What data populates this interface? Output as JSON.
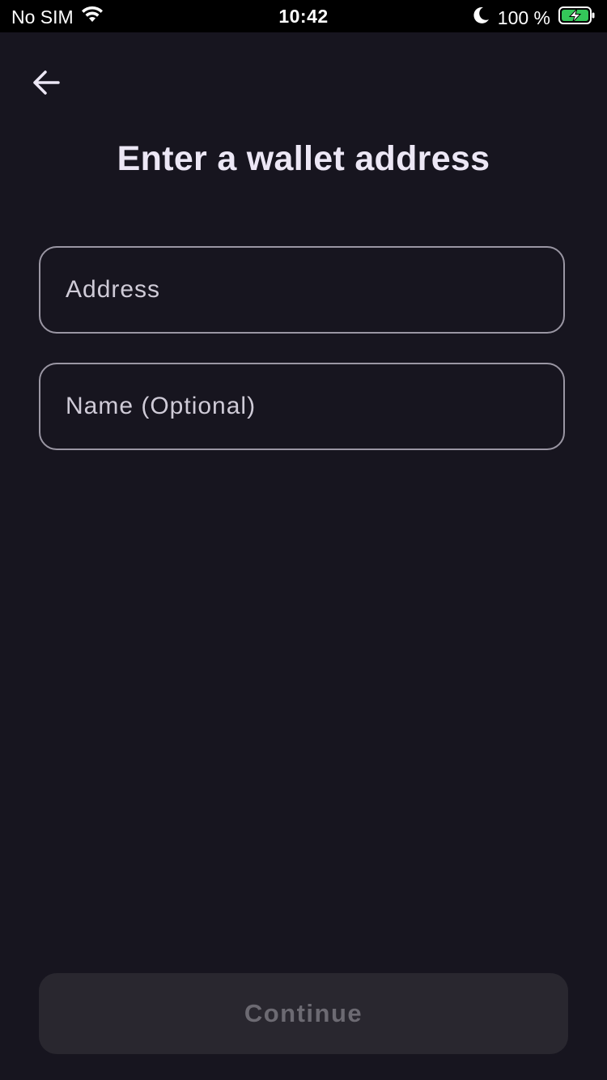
{
  "status_bar": {
    "carrier": "No SIM",
    "time": "10:42",
    "battery_percent": "100 %",
    "icons": [
      "wifi-icon",
      "moon-icon",
      "battery-charging-icon"
    ]
  },
  "header": {
    "back_icon": "arrow-left-icon",
    "title": "Enter a wallet address"
  },
  "form": {
    "address": {
      "value": "",
      "placeholder": "Address"
    },
    "name": {
      "value": "",
      "placeholder": "Name (Optional)"
    }
  },
  "footer": {
    "continue_label": "Continue",
    "continue_enabled": false
  },
  "colors": {
    "background": "#17151f",
    "title": "#ece7f5",
    "field_border": "#9a96a3",
    "button_disabled_bg": "#29272f",
    "button_disabled_text": "#6c6a72",
    "battery_green": "#34c759"
  }
}
